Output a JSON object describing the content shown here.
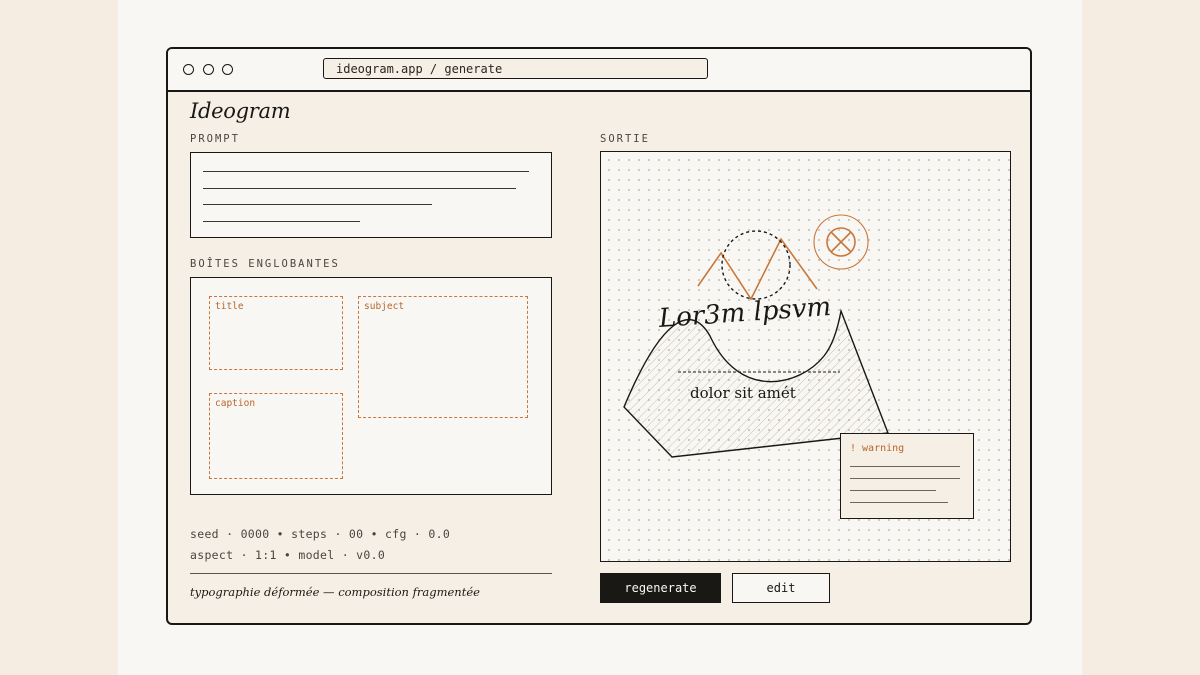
{
  "browser": {
    "url": "ideogram.app / generate"
  },
  "app": {
    "brand": "Ideogram"
  },
  "prompt": {
    "label": "PROMPT"
  },
  "bounding_boxes": {
    "label": "BOÎTES ENGLOBANTES",
    "items": [
      {
        "label": "title"
      },
      {
        "label": "subject"
      },
      {
        "label": "caption"
      }
    ]
  },
  "params": {
    "line1": "seed · 0000 • steps · 00 • cfg · 0.0",
    "line2": "aspect · 1:1 • model · v0.0"
  },
  "footer_caption": "typographie déformée — composition fragmentée",
  "output": {
    "label": "SORTIE",
    "headline": "Lor3m lpsvm",
    "subline": "dolor sit amét",
    "warning_title": "! warning"
  },
  "actions": {
    "regenerate": "regenerate",
    "edit": "edit"
  },
  "colors": {
    "accent": "#c8783c",
    "ink": "#1a1814",
    "paper": "#f8f7f3",
    "panel": "#f5efe6"
  },
  "icons": {
    "window_controls": "circle-outline",
    "output_badge": "crossed-circle-icon"
  }
}
